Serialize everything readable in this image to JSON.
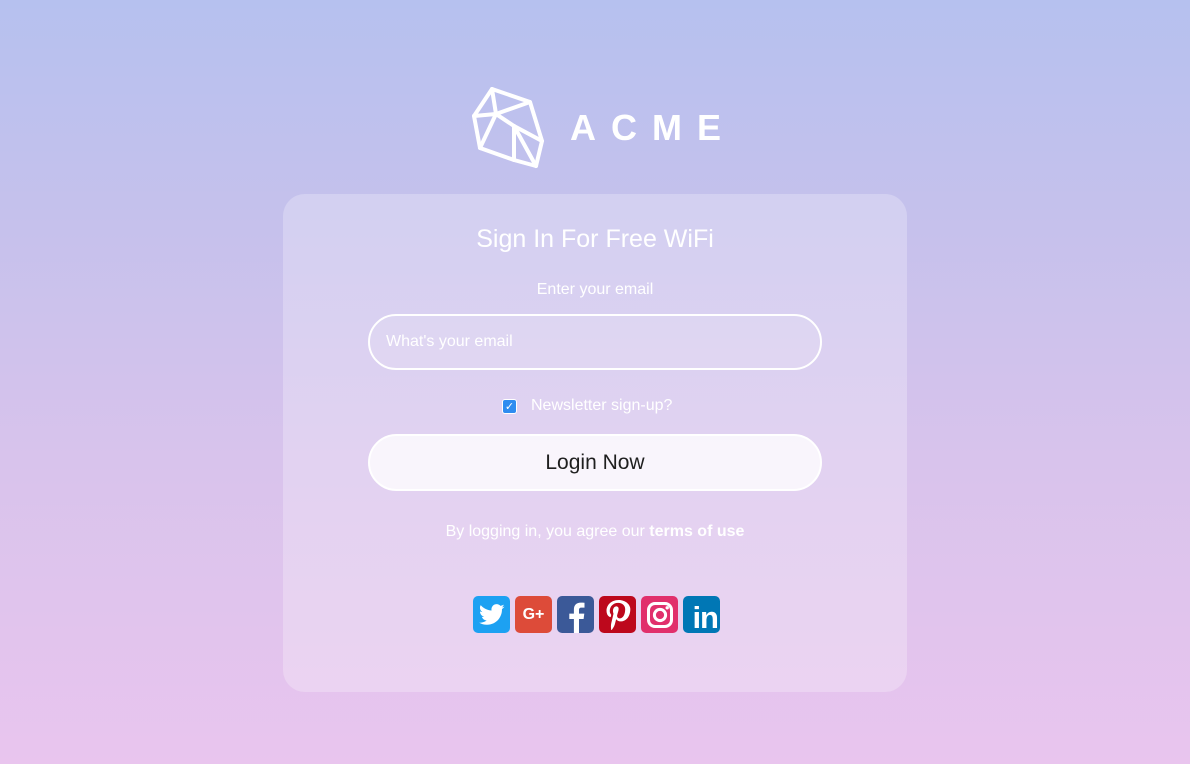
{
  "brand": {
    "name": "ACME"
  },
  "form": {
    "title": "Sign In For Free WiFi",
    "email_label": "Enter your email",
    "email_placeholder": "What's your email",
    "email_value": "",
    "newsletter_label": "Newsletter sign-up?",
    "newsletter_checked": true,
    "login_label": "Login Now",
    "terms_prefix": "By logging in, you agree our",
    "terms_link": "terms of use"
  },
  "socials": [
    {
      "name": "twitter",
      "icon": "twitter-icon",
      "color": "#1da1f2"
    },
    {
      "name": "google-plus",
      "icon": "google-plus-icon",
      "color": "#dd4b39",
      "text": "G+"
    },
    {
      "name": "facebook",
      "icon": "facebook-icon",
      "color": "#3b5998"
    },
    {
      "name": "pinterest",
      "icon": "pinterest-icon",
      "color": "#bd081c"
    },
    {
      "name": "instagram",
      "icon": "instagram-icon",
      "color": "#e1306c"
    },
    {
      "name": "linkedin",
      "icon": "linkedin-icon",
      "color": "#0077b5",
      "text": "in"
    }
  ],
  "colors": {
    "accent": "#2e8cf0",
    "background_top": "#b6c1ef",
    "background_bottom": "#e9c5ee"
  }
}
